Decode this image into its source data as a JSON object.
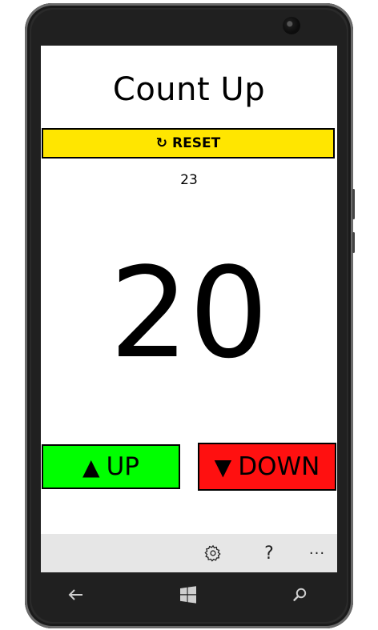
{
  "app": {
    "title": "Count Up"
  },
  "reset": {
    "icon": "↻",
    "label": "RESET"
  },
  "counter": {
    "total": "23",
    "value": "20"
  },
  "controls": {
    "up_icon": "▲",
    "up_label": "UP",
    "down_icon": "▼",
    "down_label": "DOWN"
  },
  "appbar": {
    "help_glyph": "?",
    "more_glyph": "···"
  },
  "icons": {
    "settings": "gear-icon",
    "help": "question-icon",
    "more": "ellipsis-icon",
    "back": "back-arrow-icon",
    "start": "windows-logo-icon",
    "search": "search-icon"
  },
  "colors": {
    "reset_bg": "#ffe600",
    "up_bg": "#00ff00",
    "down_bg": "#ff1010",
    "appbar_bg": "#e6e6e6"
  }
}
